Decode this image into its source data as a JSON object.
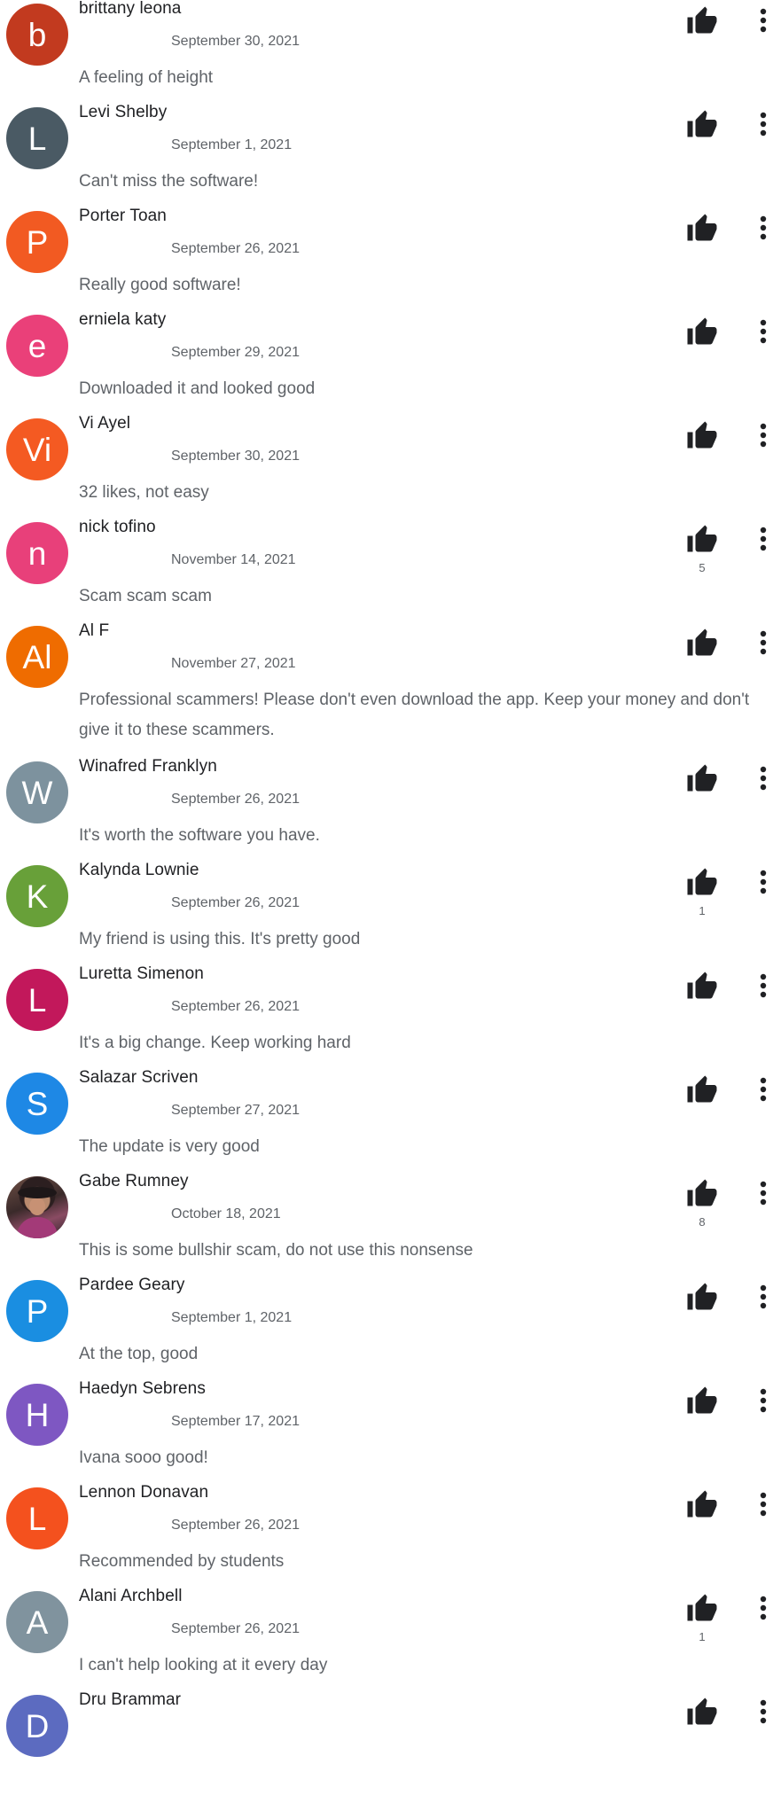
{
  "reviews": [
    {
      "initial": "b",
      "color": "#c23a1f",
      "name": "brittany leona",
      "date": "September 30, 2021",
      "text": "A feeling of height",
      "likes": ""
    },
    {
      "initial": "L",
      "color": "#4a5a64",
      "name": "Levi Shelby",
      "date": "September 1, 2021",
      "text": "Can't miss the software!",
      "likes": ""
    },
    {
      "initial": "P",
      "color": "#f25a22",
      "name": "Porter Toan",
      "date": "September 26, 2021",
      "text": "Really good software!",
      "likes": ""
    },
    {
      "initial": "e",
      "color": "#ea4079",
      "name": "erniela katy",
      "date": "September 29, 2021",
      "text": "Downloaded it and looked good",
      "likes": ""
    },
    {
      "initial": "Vi",
      "color": "#f45a22",
      "name": "Vi Ayel",
      "date": "September 30, 2021",
      "text": "32 likes, not easy",
      "likes": ""
    },
    {
      "initial": "n",
      "color": "#e8407a",
      "name": "nick tofino",
      "date": "November 14, 2021",
      "text": "Scam scam scam",
      "likes": "5"
    },
    {
      "initial": "Al",
      "color": "#ef6c00",
      "name": "Al F",
      "date": "November 27, 2021",
      "text": "Professional scammers! Please don't even download the app. Keep your money and don't give it to these scammers.",
      "likes": ""
    },
    {
      "initial": "W",
      "color": "#7d929e",
      "name": "Winafred Franklyn",
      "date": "September 26, 2021",
      "text": "It's worth the software you have.",
      "likes": ""
    },
    {
      "initial": "K",
      "color": "#68a039",
      "name": "Kalynda Lownie",
      "date": "September 26, 2021",
      "text": "My friend is using this. It's pretty good",
      "likes": "1"
    },
    {
      "initial": "L",
      "color": "#c2185b",
      "name": "Luretta Simenon",
      "date": "September 26, 2021",
      "text": "It's a big change. Keep working hard",
      "likes": ""
    },
    {
      "initial": "S",
      "color": "#1e88e5",
      "name": "Salazar Scriven",
      "date": "September 27, 2021",
      "text": "The update is very good",
      "likes": ""
    },
    {
      "initial": "",
      "color": "#4b3434",
      "photo": true,
      "name": "Gabe Rumney",
      "date": "October 18, 2021",
      "text": "This is some bullshir scam, do not use this nonsense",
      "likes": "8"
    },
    {
      "initial": "P",
      "color": "#1a8ee1",
      "name": "Pardee Geary",
      "date": "September 1, 2021",
      "text": "At the top, good",
      "likes": ""
    },
    {
      "initial": "H",
      "color": "#7e57c2",
      "name": "Haedyn Sebrens",
      "date": "September 17, 2021",
      "text": "Ivana sooo good!",
      "likes": ""
    },
    {
      "initial": "L",
      "color": "#f4511e",
      "name": "Lennon Donavan",
      "date": "September 26, 2021",
      "text": "Recommended by students",
      "likes": ""
    },
    {
      "initial": "A",
      "color": "#80939e",
      "name": "Alani Archbell",
      "date": "September 26, 2021",
      "text": "I can't help looking at it every day",
      "likes": "1"
    },
    {
      "initial": "D",
      "color": "#5c6bc0",
      "name": "Dru Brammar",
      "date": "",
      "text": "",
      "likes": ""
    }
  ],
  "icons": {
    "like": "thumb-up-icon",
    "more": "more-vert-icon"
  }
}
